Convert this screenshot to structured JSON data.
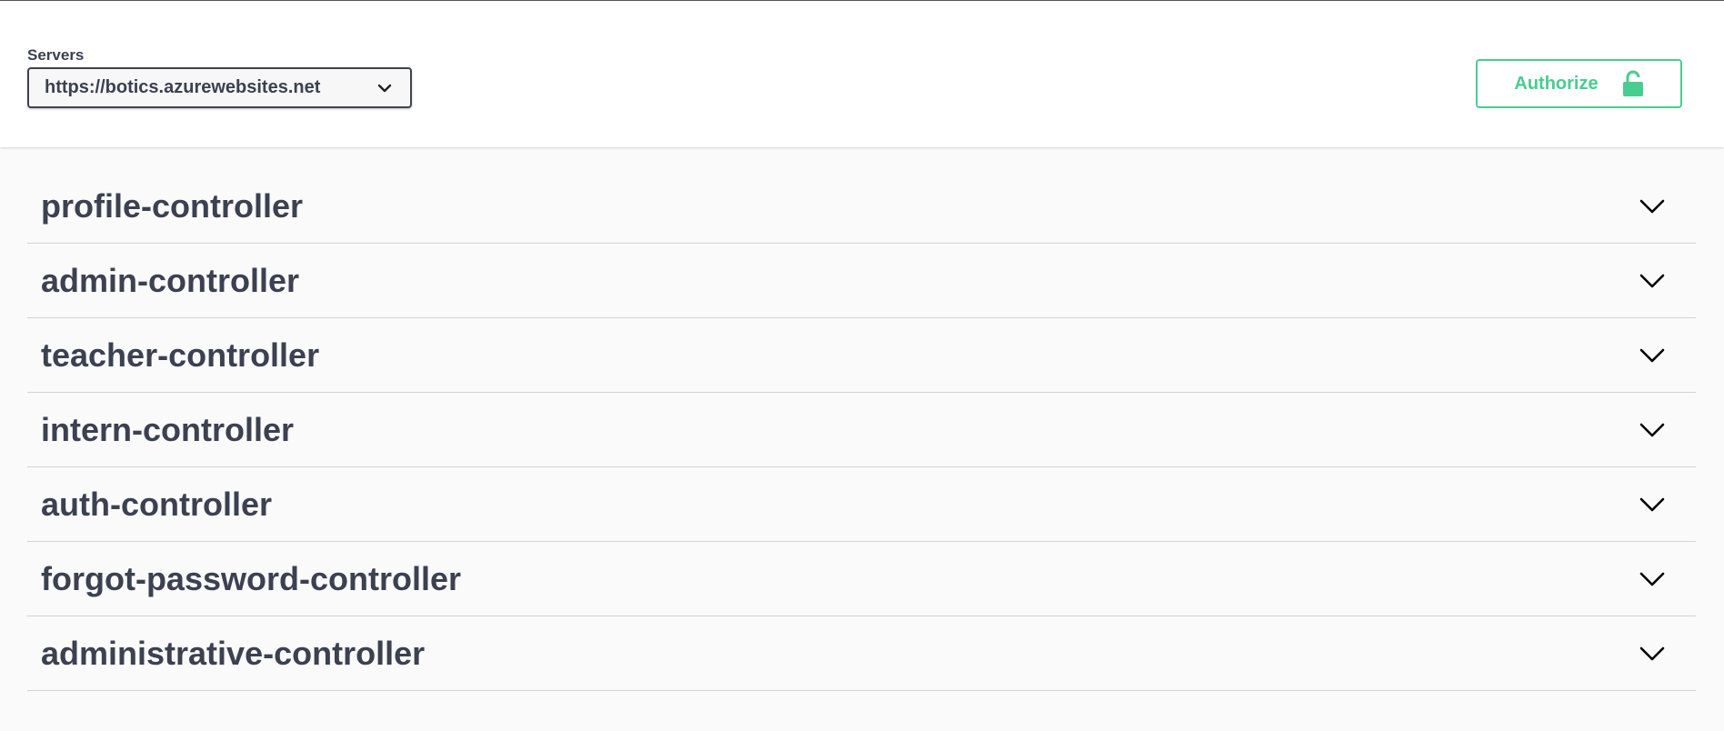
{
  "servers": {
    "label": "Servers",
    "selected": "https://botics.azurewebsites.net"
  },
  "authorize": {
    "label": "Authorize",
    "icon": "unlocked-padlock-icon",
    "color": "#49cc90"
  },
  "colors": {
    "text": "#3b4151",
    "page_background": "#fafafa"
  },
  "tags": [
    {
      "name": "profile-controller"
    },
    {
      "name": "admin-controller"
    },
    {
      "name": "teacher-controller"
    },
    {
      "name": "intern-controller"
    },
    {
      "name": "auth-controller"
    },
    {
      "name": "forgot-password-controller"
    },
    {
      "name": "administrative-controller"
    }
  ]
}
